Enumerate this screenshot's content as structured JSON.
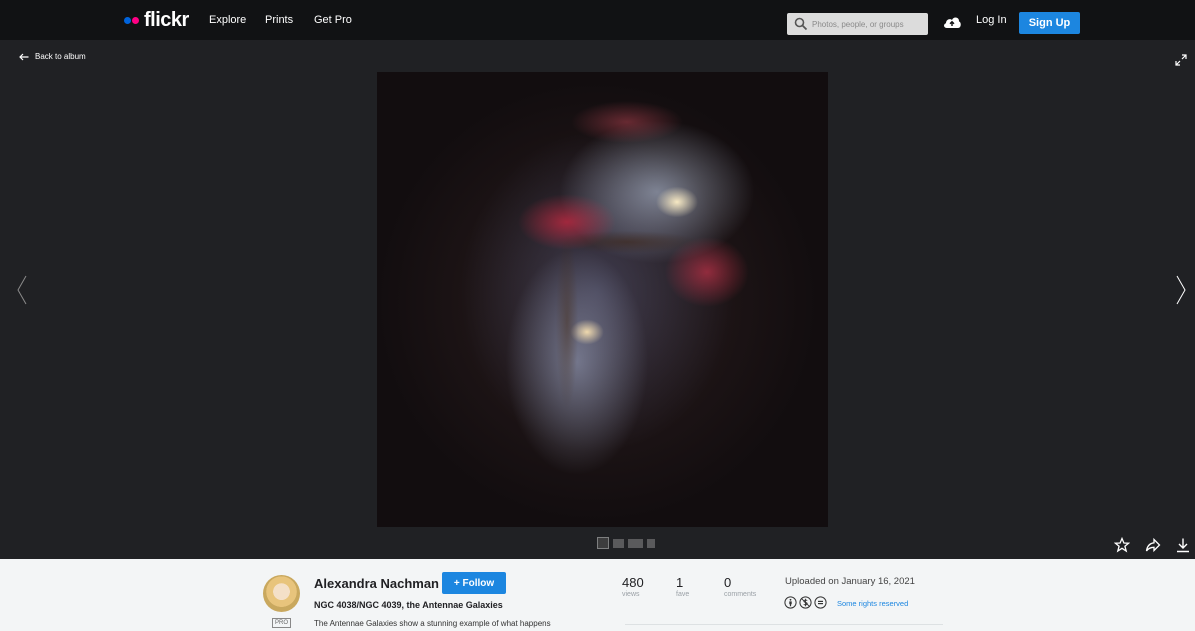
{
  "nav": {
    "logo_text": "flickr",
    "links": [
      "Explore",
      "Prints",
      "Get Pro"
    ],
    "search_placeholder": "Photos, people, or groups",
    "login_label": "Log In",
    "signup_label": "Sign Up"
  },
  "stage": {
    "back_label": "Back to album"
  },
  "info": {
    "author_name": "Alexandra Nachman",
    "follow_label": "+ Follow",
    "pro_badge": "PRO",
    "photo_title": "NGC 4038/NGC 4039, the Antennae Galaxies",
    "description": "The Antennae Galaxies show a stunning example of what happens",
    "stats": [
      {
        "value": "480",
        "label": "views"
      },
      {
        "value": "1",
        "label": "fave"
      },
      {
        "value": "0",
        "label": "comments"
      }
    ],
    "uploaded": "Uploaded on January 16, 2021",
    "rights": "Some rights reserved"
  },
  "colors": {
    "nav_bg": "#111214",
    "stage_bg": "#202124",
    "accent_blue": "#1c86e0",
    "info_bg": "#f3f5f6"
  },
  "icons": [
    "search-icon",
    "upload-cloud-icon",
    "back-arrow-icon",
    "expand-icon",
    "prev-arrow-icon",
    "next-arrow-icon",
    "star-icon",
    "share-icon",
    "download-icon",
    "cc-by-icon",
    "cc-nc-icon",
    "cc-nd-icon"
  ]
}
